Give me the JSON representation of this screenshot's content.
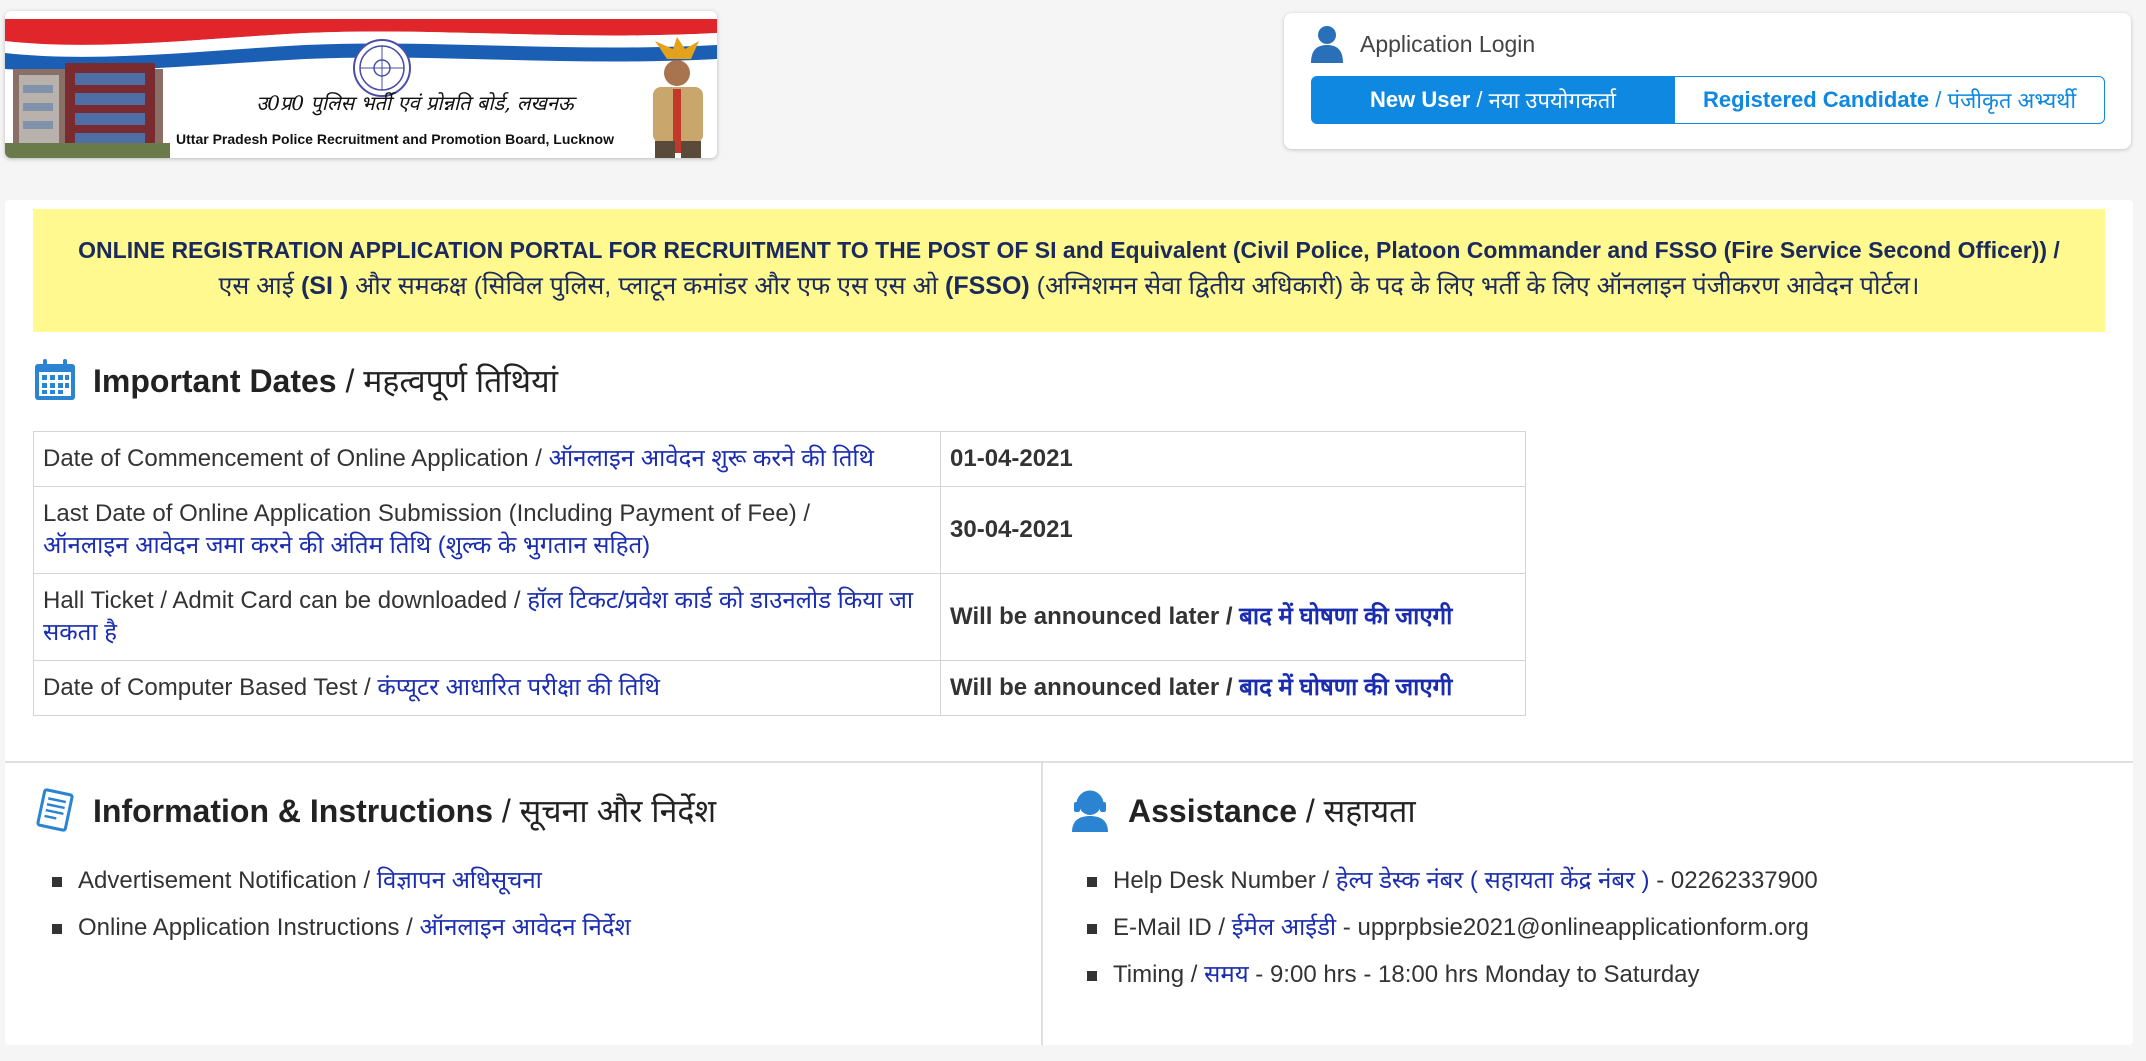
{
  "header": {
    "logo_hindi": "उ0प्र0 पुलिस भर्ती एवं प्रोन्नति बोर्ड, लखनऊ",
    "logo_english": "Uttar Pradesh Police Recruitment and Promotion Board, Lucknow"
  },
  "login": {
    "title": "Application Login",
    "new_user_en": "New User",
    "new_user_hi": "नया उपयोगकर्ता",
    "registered_en": "Registered Candidate",
    "registered_hi": "पंजीकृत अभ्यर्थी"
  },
  "banner": {
    "line1": "ONLINE REGISTRATION APPLICATION PORTAL FOR RECRUITMENT TO THE POST OF SI and Equivalent (Civil Police, Platoon Commander and FSSO (Fire Service Second Officer)) /",
    "line2_a": "एस आई ",
    "line2_b": "(SI )",
    "line2_c": " और समकक्ष (सिविल पुलिस, प्लाटून कमांडर और एफ एस एस ओ ",
    "line2_d": "(FSSO)",
    "line2_e": " (अग्निशमन सेवा द्वितीय अधिकारी) के पद के लिए भर्ती के लिए ऑनलाइन पंजीकरण आवेदन पोर्टल।"
  },
  "important_dates": {
    "heading_en": "Important Dates",
    "heading_hi": "महत्वपूर्ण तिथियां",
    "rows": [
      {
        "label_en": "Date of Commencement of Online Application / ",
        "label_hi": "ऑनलाइन आवेदन शुरू करने की तिथि",
        "value_en": "01-04-2021",
        "value_hi": ""
      },
      {
        "label_en": "Last Date of Online Application Submission (Including Payment of Fee) / ",
        "label_hi": "ऑनलाइन आवेदन जमा करने की अंतिम तिथि (शुल्क के भुगतान सहित)",
        "value_en": "30-04-2021",
        "value_hi": ""
      },
      {
        "label_en": "Hall Ticket / Admit Card can be downloaded / ",
        "label_hi": "हॉल टिकट/प्रवेश कार्ड को डाउनलोड किया जा सकता है",
        "value_en": "Will be announced later / ",
        "value_hi": "बाद में घोषणा की जाएगी"
      },
      {
        "label_en": "Date of Computer Based Test / ",
        "label_hi": "कंप्यूटर आधारित परीक्षा की तिथि",
        "value_en": "Will be announced later / ",
        "value_hi": "बाद में घोषणा की जाएगी"
      }
    ]
  },
  "information": {
    "heading_en": "Information & Instructions",
    "heading_hi": "सूचना और निर्देश",
    "items": [
      {
        "en": "Advertisement Notification / ",
        "hi": "विज्ञापन अधिसूचना"
      },
      {
        "en": "Online Application Instructions / ",
        "hi": "ऑनलाइन आवेदन निर्देश"
      }
    ]
  },
  "assistance": {
    "heading_en": "Assistance",
    "heading_hi": "सहायता",
    "items": [
      {
        "en": "Help Desk Number / ",
        "hi": "हेल्प डेस्क नंबर ( सहायता केंद्र नंबर )",
        "value": " - 02262337900"
      },
      {
        "en": "E-Mail ID / ",
        "hi": "ईमेल आईडी",
        "value": " - upprpbsie2021@onlineapplicationform.org"
      },
      {
        "en": "Timing / ",
        "hi": "समय",
        "value": " - 9:00 hrs - 18:00 hrs Monday to Saturday"
      }
    ]
  },
  "colors": {
    "primary": "#0f88e2",
    "banner_bg": "#fff98f",
    "hindi_link": "#1a2db0"
  },
  "icons": [
    "user-icon",
    "calendar-icon",
    "document-icon",
    "support-agent-icon",
    "emblem-icon"
  ]
}
